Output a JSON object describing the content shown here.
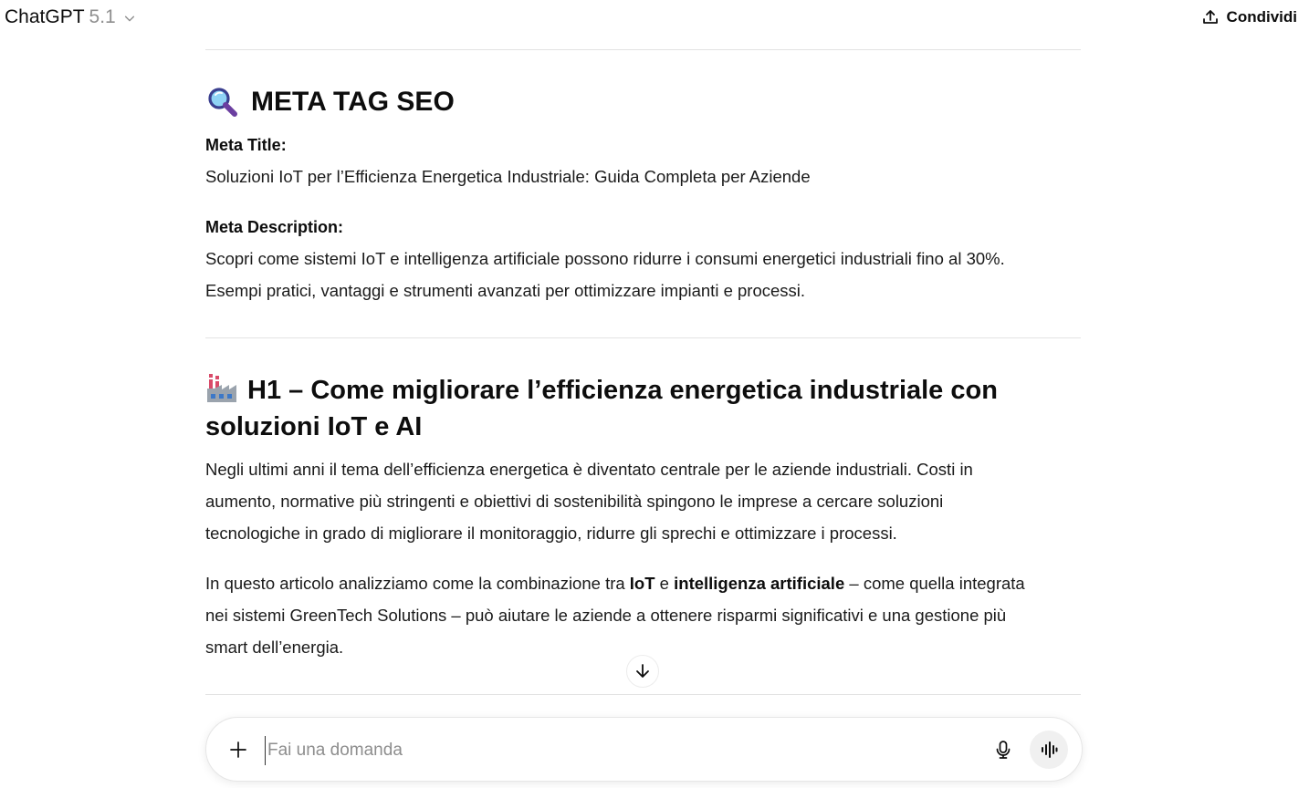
{
  "header": {
    "model_name": "ChatGPT",
    "model_version": "5.1",
    "share_label": "Condividi"
  },
  "sections": {
    "meta": {
      "heading": "META TAG SEO",
      "title_label": "Meta Title:",
      "title_value": "Soluzioni IoT per l’Efficienza Energetica Industriale: Guida Completa per Aziende",
      "description_label": "Meta Description:",
      "description_line1": "Scopri come sistemi IoT e intelligenza artificiale possono ridurre i consumi energetici industriali fino al 30%.",
      "description_line2": "Esempi pratici, vantaggi e strumenti avanzati per ottimizzare impianti e processi."
    },
    "h1": {
      "heading_line1": "H1 – Come migliorare l’efficienza energetica industriale con",
      "heading_line2": "soluzioni IoT e AI",
      "para1_line1": "Negli ultimi anni il tema dell’efficienza energetica è diventato centrale per le aziende industriali. Costi in",
      "para1_line2": "aumento, normative più stringenti e obiettivi di sostenibilità spingono le imprese a cercare soluzioni",
      "para1_line3": "tecnologiche in grado di migliorare il monitoraggio, ridurre gli sprechi e ottimizzare i processi.",
      "para2_pre": "In questo articolo analizziamo come la combinazione tra ",
      "para2_bold1": "IoT",
      "para2_mid": " e ",
      "para2_bold2": "intelligenza artificiale",
      "para2_post": " – come quella integrata",
      "para2_line2": "nei sistemi GreenTech Solutions – può aiutare le aziende a ottenere risparmi significativi e una gestione più",
      "para2_line3": "smart dell’energia."
    }
  },
  "composer": {
    "placeholder": "Fai una domanda"
  },
  "icons": {
    "meta_heading": "magnifying-glass-emoji",
    "h1_heading": "factory-emoji",
    "share": "upload-icon",
    "model_menu": "chevron-down-icon",
    "scroll": "arrow-down-icon",
    "attach": "plus-icon",
    "mic": "microphone-icon",
    "voice": "voice-waveform-icon"
  }
}
